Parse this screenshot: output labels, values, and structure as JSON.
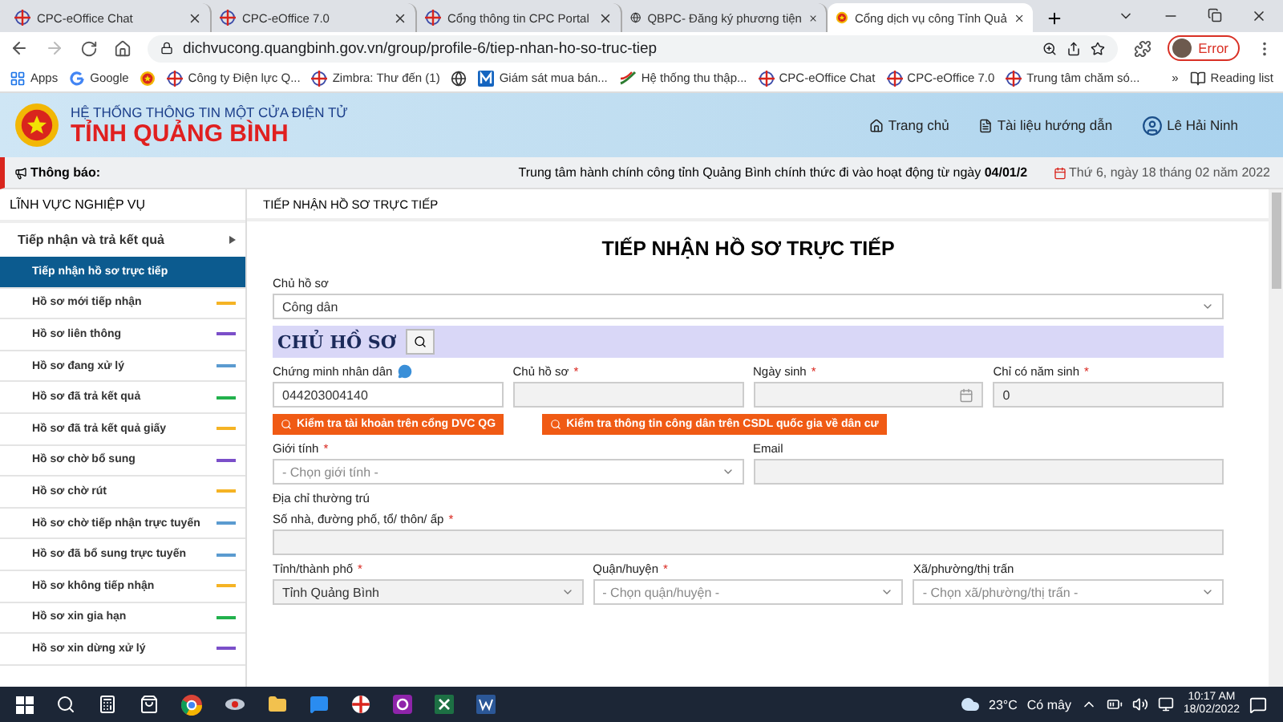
{
  "browser": {
    "tabs": [
      {
        "title": "CPC-eOffice Chat",
        "kind": "cpc",
        "selected": false
      },
      {
        "title": "CPC-eOffice 7.0",
        "kind": "cpc",
        "selected": false
      },
      {
        "title": "Cổng thông tin CPC Portal",
        "kind": "cpc",
        "selected": false
      },
      {
        "title": "QBPC- Đăng ký phương tiện",
        "kind": "globe",
        "selected": false
      },
      {
        "title": "Cổng dịch vụ công Tỉnh Quả",
        "kind": "emblem",
        "selected": true
      }
    ],
    "address": "dichvucong.quangbinh.gov.vn/group/profile-6/tiep-nhan-ho-so-truc-tiep",
    "profile": "Error",
    "bookmarks": [
      {
        "label": "Apps",
        "kind": "grid"
      },
      {
        "label": "Google",
        "kind": "google"
      },
      {
        "kind": "emblem"
      },
      {
        "label": "Công ty Điện lực Q...",
        "kind": "cpc"
      },
      {
        "label": "Zimbra: Thư đến (1)",
        "kind": "cpc"
      },
      {
        "kind": "globe"
      },
      {
        "label": "Giám sát mua bán...",
        "kind": "m"
      },
      {
        "label": "Hệ thống thu thập...",
        "kind": "ht"
      },
      {
        "label": "CPC-eOffice Chat",
        "kind": "cpc"
      },
      {
        "label": "CPC-eOffice 7.0",
        "kind": "cpc"
      },
      {
        "label": "Trung tâm chăm só...",
        "kind": "cpc"
      }
    ],
    "more": "»",
    "reading_list": "Reading list"
  },
  "header": {
    "subtitle": "HỆ THỐNG THÔNG TIN MỘT CỬA ĐIỆN TỬ",
    "title": "TỈNH QUẢNG BÌNH",
    "nav": [
      {
        "label": "Trang chủ",
        "kind": "home"
      },
      {
        "label": "Tài liệu hướng dẫn",
        "kind": "doc"
      },
      {
        "label": "Lê Hải Ninh",
        "kind": "user"
      }
    ]
  },
  "notice": {
    "label": "Thông báo:",
    "text": "Trung tâm hành chính công tỉnh Quảng Bình chính thức đi vào hoạt động từ ngày **04/01/2**",
    "date": "Thứ 6, ngày 18 tháng 02 năm 2022"
  },
  "sidebar": {
    "title": "LĨNH VỰC NGHIỆP VỤ",
    "group": "Tiếp nhận và trả kết quả",
    "items": [
      {
        "label": "Tiếp nhận hồ sơ trực tiếp",
        "selected": true
      },
      {
        "label": "Hồ sơ mới tiếp nhận",
        "selected": false,
        "color": "#f5b324"
      },
      {
        "label": "Hồ sơ liên thông",
        "selected": false,
        "color": "#7b4fc9"
      },
      {
        "label": "Hồ sơ đang xử lý",
        "selected": false,
        "color": "#5b9bd0"
      },
      {
        "label": "Hồ sơ đã trả kết quả",
        "selected": false,
        "color": "#22b14c"
      },
      {
        "label": "Hồ sơ đã trả kết quả giấy",
        "selected": false,
        "color": "#f5b324"
      },
      {
        "label": "Hồ sơ chờ bổ sung",
        "selected": false,
        "color": "#7b4fc9"
      },
      {
        "label": "Hồ sơ chờ rút",
        "selected": false,
        "color": "#f5b324"
      },
      {
        "label": "Hồ sơ chờ tiếp nhận trực tuyến",
        "selected": false,
        "color": "#5b9bd0"
      },
      {
        "label": "Hồ sơ đã bổ sung trực tuyến",
        "selected": false,
        "color": "#5b9bd0"
      },
      {
        "label": "Hồ sơ không tiếp nhận",
        "selected": false,
        "color": "#f5b324"
      },
      {
        "label": "Hồ sơ xin gia hạn",
        "selected": false,
        "color": "#22b14c"
      },
      {
        "label": "Hồ sơ xin dừng xử lý",
        "selected": false,
        "color": "#7b4fc9"
      }
    ]
  },
  "main": {
    "required_mark": "*",
    "breadcrumb": "TIẾP NHẬN HỒ SƠ TRỰC TIẾP",
    "title": "TIẾP NHẬN HỒ SƠ TRỰC TIẾP",
    "owner_type": {
      "label": "Chủ hồ sơ",
      "value": "Công dân"
    },
    "section": "CHỦ HỒ SƠ",
    "row1": [
      {
        "label": "Chứng minh nhân dân",
        "kind": "input",
        "value": "044203004140",
        "required": false,
        "disabled": false,
        "note": true
      },
      {
        "label": "Chủ hồ sơ",
        "kind": "input",
        "required": true,
        "disabled": true
      },
      {
        "label": "Ngày sinh",
        "kind": "date",
        "required": true,
        "disabled": true
      },
      {
        "label": "Chỉ có năm sinh",
        "kind": "input",
        "value": "0",
        "required": true,
        "disabled": true
      }
    ],
    "checks": [
      "Kiểm tra tài khoản trên cổng DVC QG",
      "Kiểm tra thông tin công dân trên CSDL quốc gia về dân cư"
    ],
    "row2": [
      {
        "label": "Giới tính",
        "kind": "select",
        "placeholder": "- Chọn giới tính -",
        "required": true,
        "disabled": false
      },
      {
        "label": "Email",
        "kind": "input",
        "required": false,
        "disabled": true
      }
    ],
    "address_title": "Địa chỉ thường trú",
    "row3": [
      {
        "label": "Số nhà, đường phố, tổ/ thôn/ ấp",
        "kind": "input",
        "required": true,
        "disabled": true
      }
    ],
    "row4": [
      {
        "label": "Tỉnh/thành phố",
        "kind": "select",
        "value": "Tỉnh Quảng Bình",
        "required": true,
        "disabled": true
      },
      {
        "label": "Quận/huyện",
        "kind": "select",
        "placeholder": "- Chọn quận/huyện -",
        "required": true,
        "disabled": false
      },
      {
        "label": "Xã/phường/thị trấn",
        "kind": "select",
        "placeholder": "- Chọn xã/phường/thị trấn -",
        "required": false,
        "disabled": false
      }
    ]
  },
  "taskbar": {
    "temperature": "23°C",
    "weather": "Có mây",
    "time": "10:17 AM",
    "date": "18/02/2022"
  }
}
